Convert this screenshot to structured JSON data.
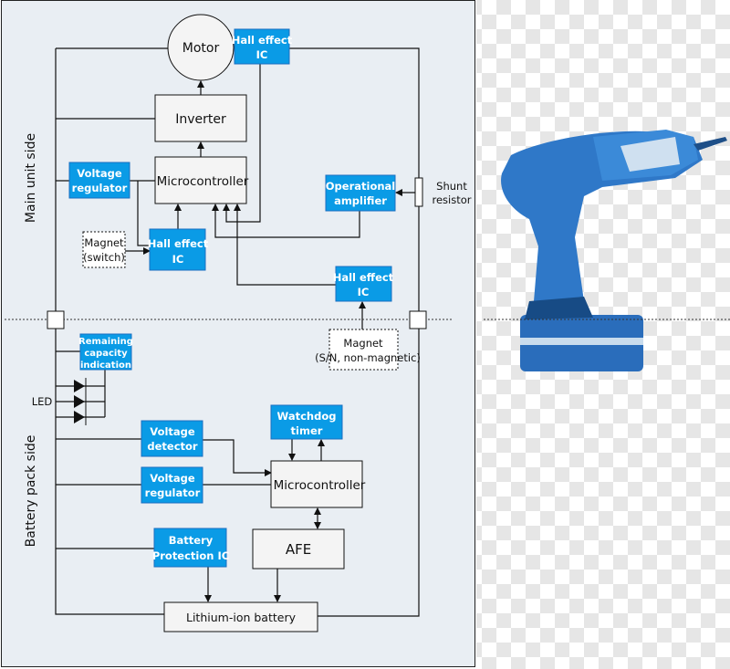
{
  "main_unit": {
    "side_label": "Main unit side",
    "motor": "Motor",
    "hall_ic_motor": [
      "Hall effect",
      "IC"
    ],
    "inverter": "Inverter",
    "microcontroller": "Microcontroller",
    "voltage_regulator": [
      "Voltage",
      "regulator"
    ],
    "operational_amplifier": [
      "Operational",
      "amplifier"
    ],
    "shunt_resistor": [
      "Shunt",
      "resistor"
    ],
    "magnet_switch": [
      "Magnet",
      "(switch)"
    ],
    "hall_ic_switch": [
      "Hall effect",
      "IC"
    ],
    "hall_ic_pack": [
      "Hall effect",
      "IC"
    ]
  },
  "battery_pack": {
    "side_label": "Battery pack side",
    "remaining_capacity": [
      "Remaining",
      "capacity",
      "indication"
    ],
    "led": "LED",
    "magnet": [
      "Magnet",
      "(S/N, non-magnetic)"
    ],
    "voltage_detector": [
      "Voltage",
      "detector"
    ],
    "watchdog_timer": [
      "Watchdog",
      "timer"
    ],
    "voltage_regulator": [
      "Voltage",
      "regulator"
    ],
    "microcontroller": "Microcontroller",
    "battery_protection_ic": [
      "Battery",
      "Protection IC"
    ],
    "afe": "AFE",
    "lithium_ion_battery": "Lithium-ion battery"
  },
  "colors": {
    "ic_blue": "#0a9be6",
    "panel": "#e9eef3",
    "drill_blue": "#2f78c8"
  }
}
